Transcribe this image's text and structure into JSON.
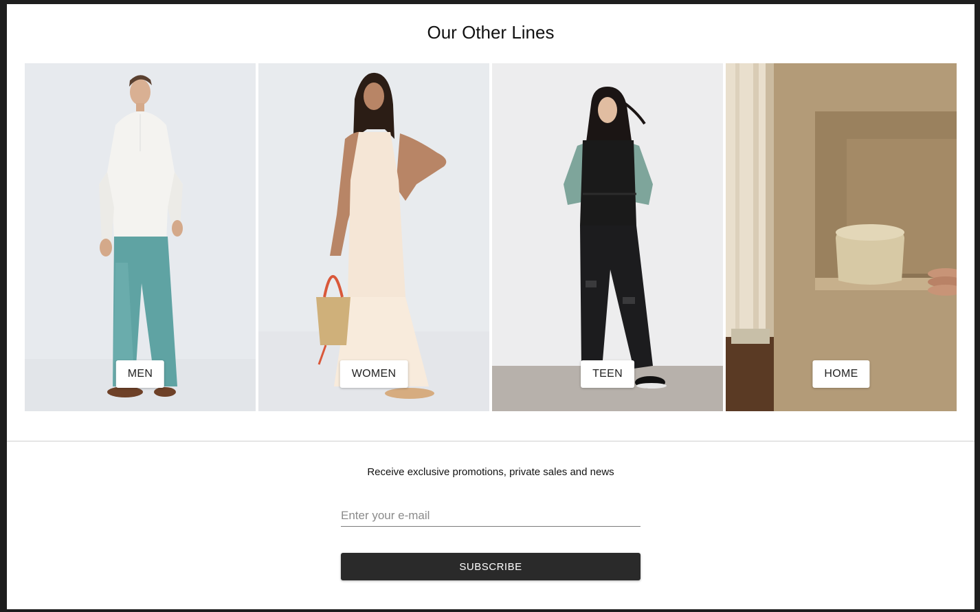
{
  "section": {
    "title": "Our Other Lines"
  },
  "lines": [
    {
      "label": "MEN",
      "image": "man-model-photo"
    },
    {
      "label": "WOMEN",
      "image": "woman-model-photo"
    },
    {
      "label": "TEEN",
      "image": "teen-model-photo"
    },
    {
      "label": "HOME",
      "image": "home-decor-photo"
    }
  ],
  "newsletter": {
    "text": "Receive exclusive promotions, private sales and news",
    "placeholder": "Enter your e-mail",
    "value": "",
    "button_label": "SUBSCRIBE"
  },
  "colors": {
    "page_bg": "#ffffff",
    "frame_bg": "#1e1e1e",
    "button_dark": "#2a2a2a"
  }
}
